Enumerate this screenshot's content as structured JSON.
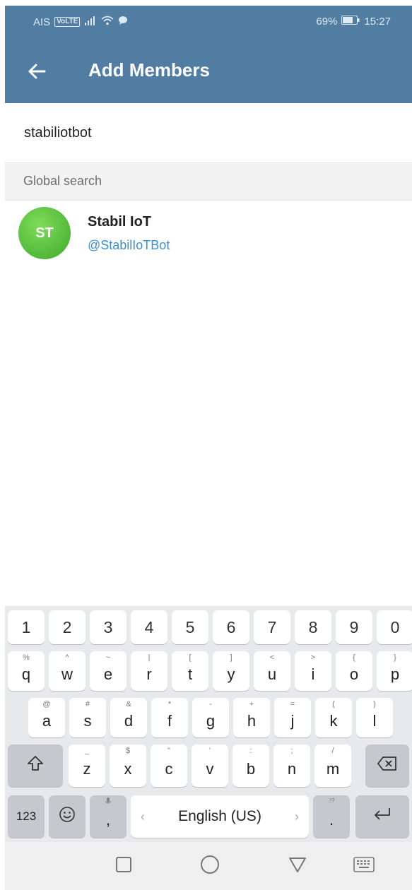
{
  "status_bar": {
    "carrier": "AIS",
    "volte": "VoLTE",
    "battery": "69%",
    "time": "15:27"
  },
  "toolbar": {
    "title": "Add Members",
    "back_icon": "arrow-left-icon"
  },
  "search": {
    "value": "stabiliotbot"
  },
  "section": {
    "header": "Global search"
  },
  "results": [
    {
      "initials": "ST",
      "name": "Stabil IoT",
      "username": "@StabilIoTBot",
      "avatar_color": "#5cc04a"
    }
  ],
  "colors": {
    "appbar": "#517da2",
    "link": "#3a8fd0",
    "keyboard_bg": "#e8e9ec"
  },
  "keyboard": {
    "numbers": [
      "1",
      "2",
      "3",
      "4",
      "5",
      "6",
      "7",
      "8",
      "9",
      "0"
    ],
    "row1": [
      {
        "key": "q",
        "hint": "%"
      },
      {
        "key": "w",
        "hint": "^"
      },
      {
        "key": "e",
        "hint": "~"
      },
      {
        "key": "r",
        "hint": "|"
      },
      {
        "key": "t",
        "hint": "["
      },
      {
        "key": "y",
        "hint": "]"
      },
      {
        "key": "u",
        "hint": "<"
      },
      {
        "key": "i",
        "hint": ">"
      },
      {
        "key": "o",
        "hint": "{"
      },
      {
        "key": "p",
        "hint": "}"
      }
    ],
    "row2": [
      {
        "key": "a",
        "hint": "@"
      },
      {
        "key": "s",
        "hint": "#"
      },
      {
        "key": "d",
        "hint": "&"
      },
      {
        "key": "f",
        "hint": "*"
      },
      {
        "key": "g",
        "hint": "-"
      },
      {
        "key": "h",
        "hint": "+"
      },
      {
        "key": "j",
        "hint": "="
      },
      {
        "key": "k",
        "hint": "("
      },
      {
        "key": "l",
        "hint": ")"
      }
    ],
    "row3": [
      {
        "key": "z",
        "hint": "_"
      },
      {
        "key": "x",
        "hint": "$"
      },
      {
        "key": "c",
        "hint": "\""
      },
      {
        "key": "v",
        "hint": "'"
      },
      {
        "key": "b",
        "hint": ":"
      },
      {
        "key": "n",
        "hint": ";"
      },
      {
        "key": "m",
        "hint": "/"
      }
    ],
    "symbols_label": "123",
    "comma": ",",
    "period": ".",
    "space_label": "English (US)",
    "space_left": "‹",
    "space_right": "›",
    "shift_icon": "shift-icon",
    "backspace_icon": "backspace-icon",
    "enter_icon": "enter-icon",
    "emoji_icon": "emoji-icon",
    "mic_icon": "mic-icon"
  },
  "nav_bar": {
    "recents_icon": "square-icon",
    "home_icon": "circle-icon",
    "back_icon": "triangle-back-icon",
    "keyboard_icon": "keyboard-icon"
  }
}
